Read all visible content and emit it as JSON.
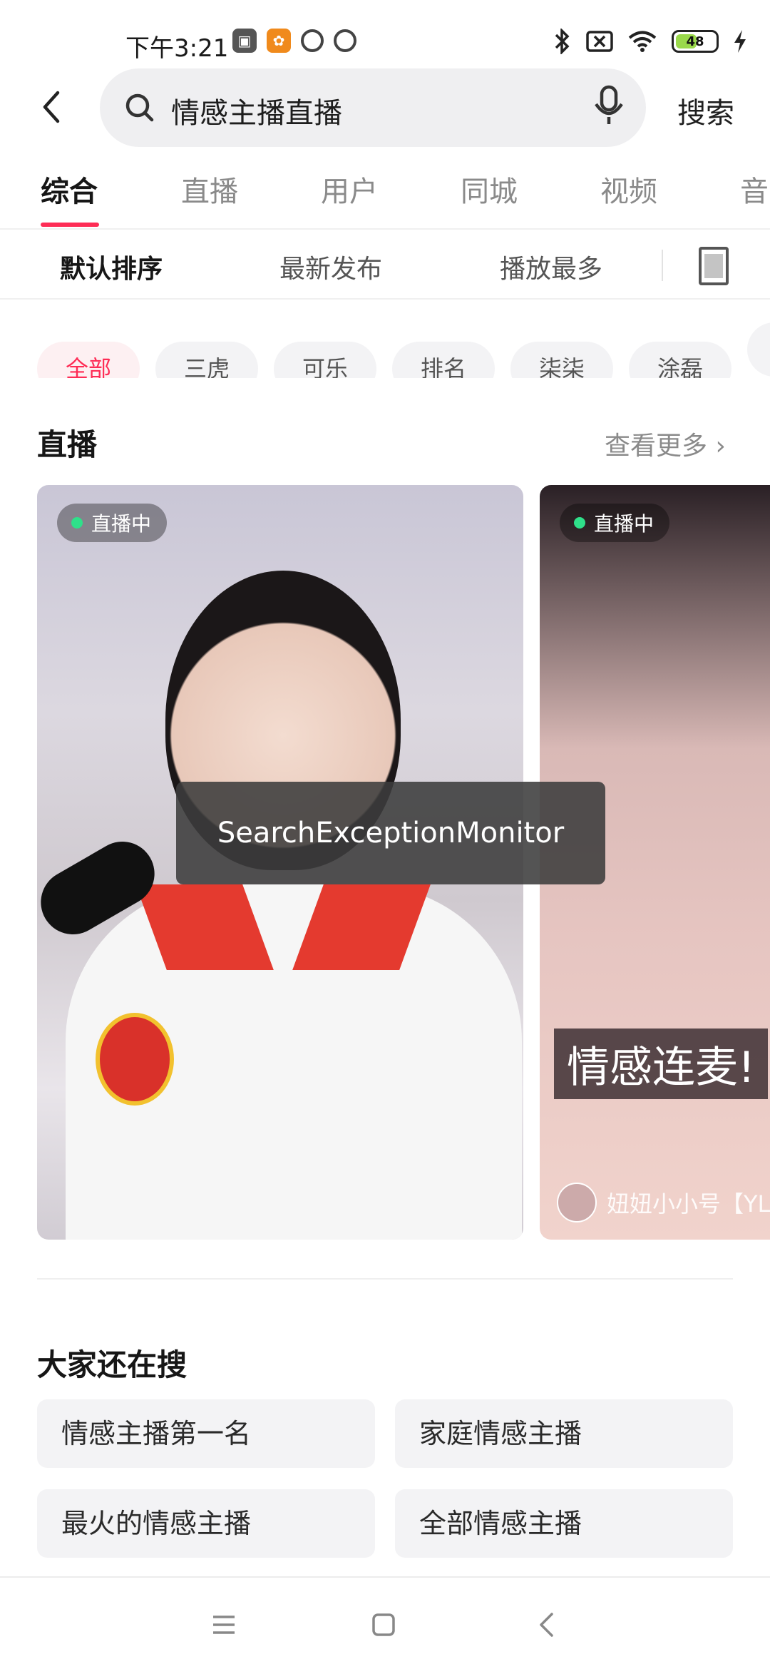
{
  "status_bar": {
    "time": "下午3:21",
    "battery": "48",
    "icons_left": [
      "mi-icon",
      "uc-browser-icon",
      "notification-ring-icon",
      "notification-ring-icon"
    ],
    "icons_right": [
      "bluetooth-icon",
      "sim-off-icon",
      "wifi-icon",
      "battery-icon",
      "charging-icon"
    ]
  },
  "search": {
    "query": "情感主播直播",
    "submit_label": "搜索"
  },
  "tabs": {
    "items": [
      "综合",
      "直播",
      "用户",
      "同城",
      "视频",
      "音"
    ],
    "active_index": 0
  },
  "sort": {
    "items": [
      "默认排序",
      "最新发布",
      "播放最多"
    ],
    "active_index": 0
  },
  "filters": {
    "chips": [
      "全部",
      "三虎",
      "可乐",
      "排名",
      "柒柒",
      "涂磊"
    ],
    "active_index": 0
  },
  "live_section": {
    "title": "直播",
    "see_more": "查看更多",
    "cards": [
      {
        "badge": "直播中",
        "caption": "",
        "user": ""
      },
      {
        "badge": "直播中",
        "caption": "情感连麦!",
        "user": "妞妞小小号【YL"
      }
    ]
  },
  "toast": {
    "text": "SearchExceptionMonitor"
  },
  "related": {
    "title": "大家还在搜",
    "items": [
      "情感主播第一名",
      "家庭情感主播",
      "最火的情感主播",
      "全部情感主播"
    ]
  },
  "colors": {
    "accent": "#fe2c55",
    "chip_bg": "#f3f3f5",
    "live_dot": "#2fe08a"
  }
}
